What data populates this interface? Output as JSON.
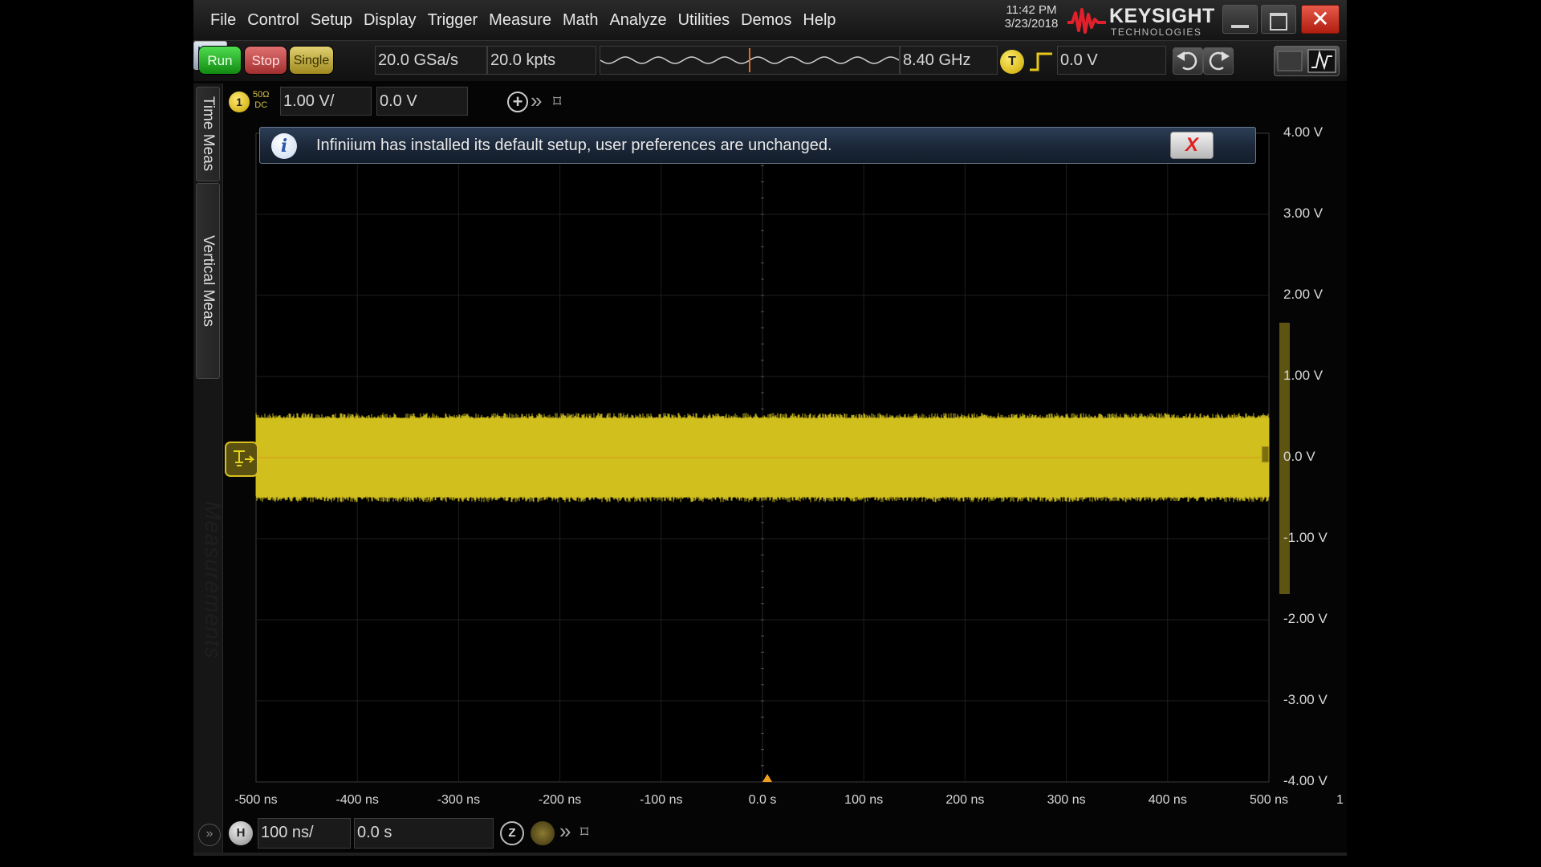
{
  "menu": {
    "items": [
      "File",
      "Control",
      "Setup",
      "Display",
      "Trigger",
      "Measure",
      "Math",
      "Analyze",
      "Utilities",
      "Demos",
      "Help"
    ]
  },
  "datetime": {
    "time": "11:42 PM",
    "date": "3/23/2018"
  },
  "brand": {
    "name": "KEYSIGHT",
    "sub": "TECHNOLOGIES",
    "accent": "#e0202a"
  },
  "window": {
    "close_glyph": "✕"
  },
  "toolbar": {
    "run_label": "Run",
    "stop_label": "Stop",
    "single_label": "Single",
    "sample_rate": "20.0 GSa/s",
    "memory_depth": "20.0 kpts",
    "bandwidth": "8.40 GHz",
    "trigger_label": "T",
    "trigger_level": "0.0 V"
  },
  "side_tabs": {
    "time_meas": "Time Meas",
    "vertical_meas": "Vertical Meas",
    "measurements": "Measurements",
    "expand": "»"
  },
  "channel1": {
    "number": "1",
    "coupling_top": "50Ω",
    "coupling_bottom": "DC",
    "scale": "1.00 V/",
    "offset": "0.0 V",
    "color": "#e6d21a"
  },
  "channel_bar": {
    "add": "+",
    "more": "»",
    "pin": "⌑"
  },
  "notification": {
    "icon": "i",
    "text": "Infiniium has installed its default setup, user preferences are unchanged.",
    "close": "X"
  },
  "grid": {
    "y_labels": [
      "4.00 V",
      "3.00 V",
      "2.00 V",
      "1.00 V",
      "0.0 V",
      "-1.00 V",
      "-2.00 V",
      "-3.00 V",
      "-4.00 V"
    ],
    "x_labels": [
      "-500 ns",
      "-400 ns",
      "-300 ns",
      "-200 ns",
      "-100 ns",
      "0.0 s",
      "100 ns",
      "200 ns",
      "300 ns",
      "400 ns",
      "500 ns"
    ],
    "corner_label": "1"
  },
  "waveform": {
    "channel": 1,
    "center_v": 0.0,
    "min_v": -0.55,
    "max_v": 0.55,
    "t_start_ns": -500,
    "t_end_ns": 500
  },
  "timebase": {
    "h_label": "H",
    "scale": "100 ns/",
    "delay": "0.0 s",
    "zoom": "Z",
    "more": "»",
    "pin": "⌑"
  }
}
